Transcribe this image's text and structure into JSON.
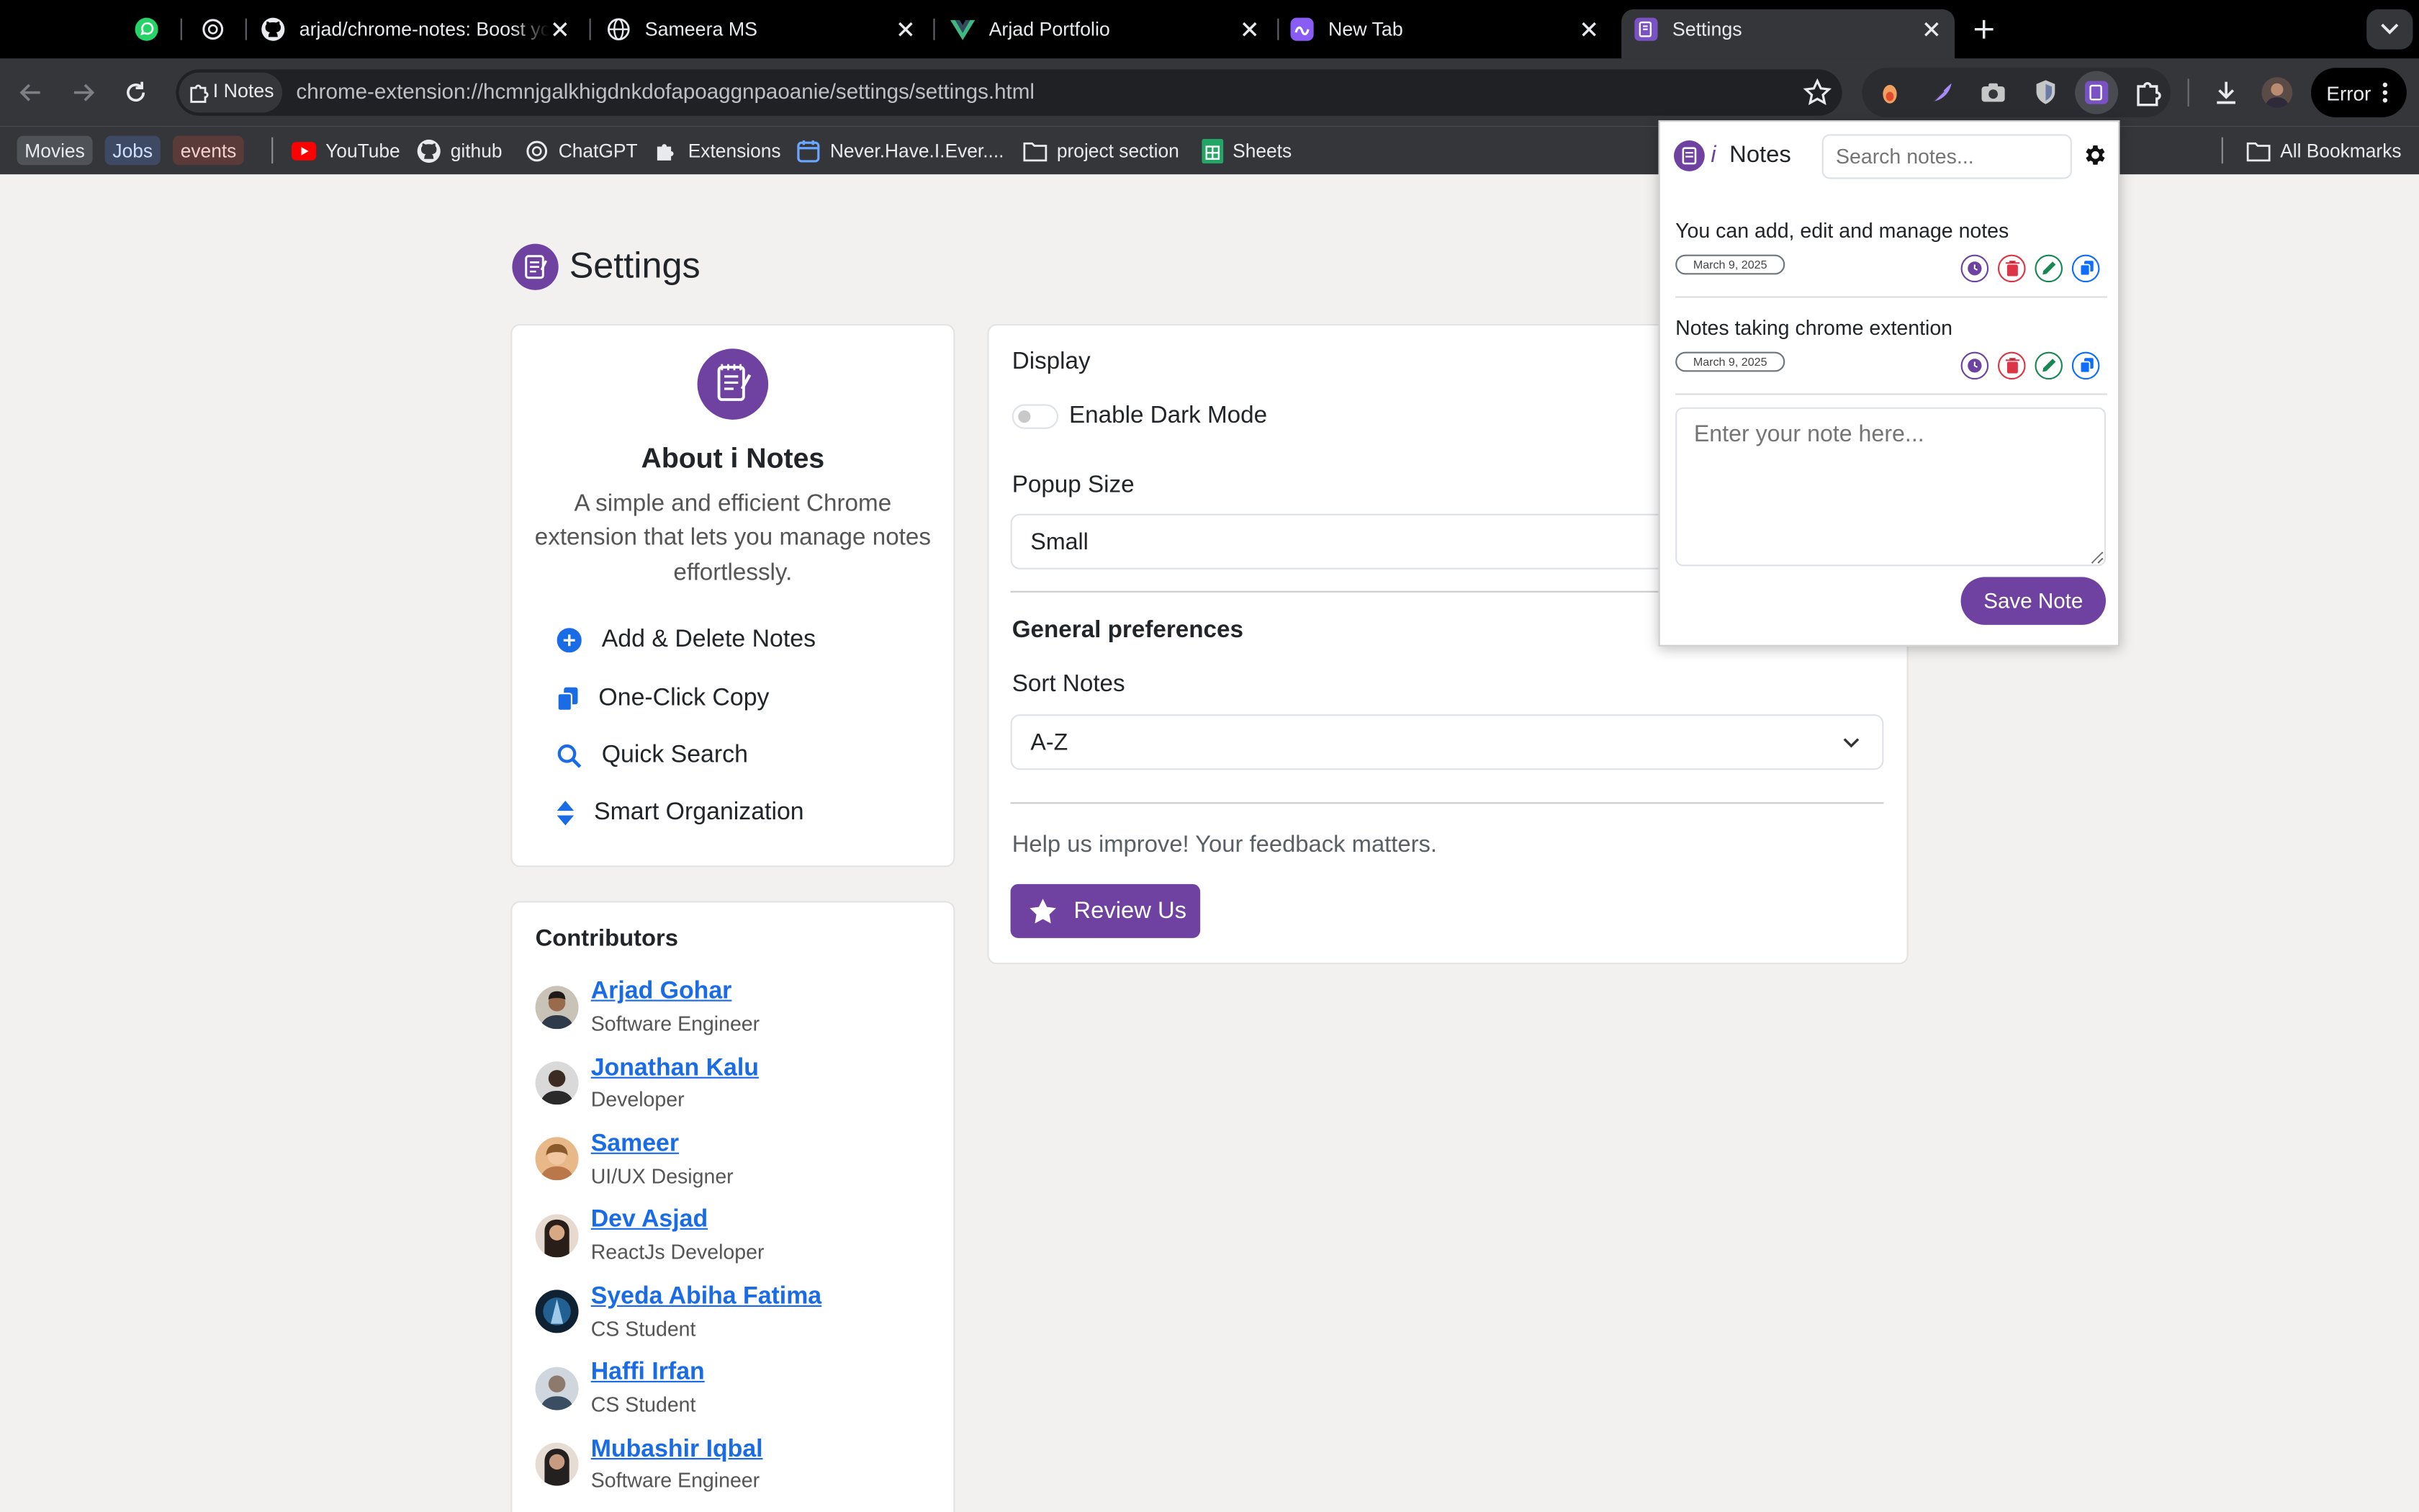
{
  "browser": {
    "tabs": [
      {
        "title": ""
      },
      {
        "title": ""
      },
      {
        "title": "arjad/chrome-notes: Boost yo"
      },
      {
        "title": "Sameera MS"
      },
      {
        "title": "Arjad Portfolio"
      },
      {
        "title": "New Tab"
      },
      {
        "title": "Settings"
      }
    ],
    "site_chip": "I Notes",
    "url": "chrome-extension://hcmnjgalkhigdnkdofapoaggnpaoanie/settings/settings.html",
    "error_label": "Error",
    "bookmarks": {
      "chips": [
        "Movies",
        "Jobs",
        "events"
      ],
      "items": [
        "YouTube",
        "github",
        "ChatGPT",
        "Extensions",
        "Never.Have.I.Ever....",
        "project section",
        "Sheets"
      ],
      "all": "All Bookmarks"
    }
  },
  "settings": {
    "page_title": "Settings",
    "about": {
      "heading": "About i Notes",
      "description": "A simple and efficient Chrome extension that lets you manage notes effortlessly.",
      "features": [
        "Add & Delete Notes",
        "One-Click Copy",
        "Quick Search",
        "Smart Organization"
      ]
    },
    "contributors": {
      "heading": "Contributors",
      "people": [
        {
          "name": "Arjad Gohar",
          "role": "Software Engineer"
        },
        {
          "name": "Jonathan Kalu",
          "role": "Developer"
        },
        {
          "name": "Sameer",
          "role": "UI/UX Designer"
        },
        {
          "name": "Dev Asjad",
          "role": "ReactJs Developer"
        },
        {
          "name": "Syeda Abiha Fatima",
          "role": "CS Student"
        },
        {
          "name": "Haffi Irfan",
          "role": "CS Student"
        },
        {
          "name": "Mubashir Iqbal",
          "role": "Software Engineer"
        }
      ]
    },
    "display": {
      "heading": "Display",
      "dark_mode_label": "Enable Dark Mode",
      "dark_mode_on": false,
      "popup_size_label": "Popup Size",
      "popup_size_value": "Small"
    },
    "general": {
      "heading": "General preferences",
      "sort_label": "Sort Notes",
      "sort_value": "A-Z"
    },
    "feedback_text": "Help us improve! Your feedback matters.",
    "review_button": "Review Us"
  },
  "popup": {
    "logo_i": "i",
    "title": "Notes",
    "search_placeholder": "Search notes...",
    "notes": [
      {
        "text": "You can add, edit and manage notes",
        "date": "March 9, 2025"
      },
      {
        "text": "Notes taking chrome extention",
        "date": "March 9, 2025"
      }
    ],
    "input_placeholder": "Enter your note here...",
    "save_button": "Save Note"
  },
  "colors": {
    "accent": "#6f42a1",
    "link": "#1a6ce6",
    "delete": "#dc3545",
    "edit": "#198754",
    "copy": "#0d6efd"
  }
}
